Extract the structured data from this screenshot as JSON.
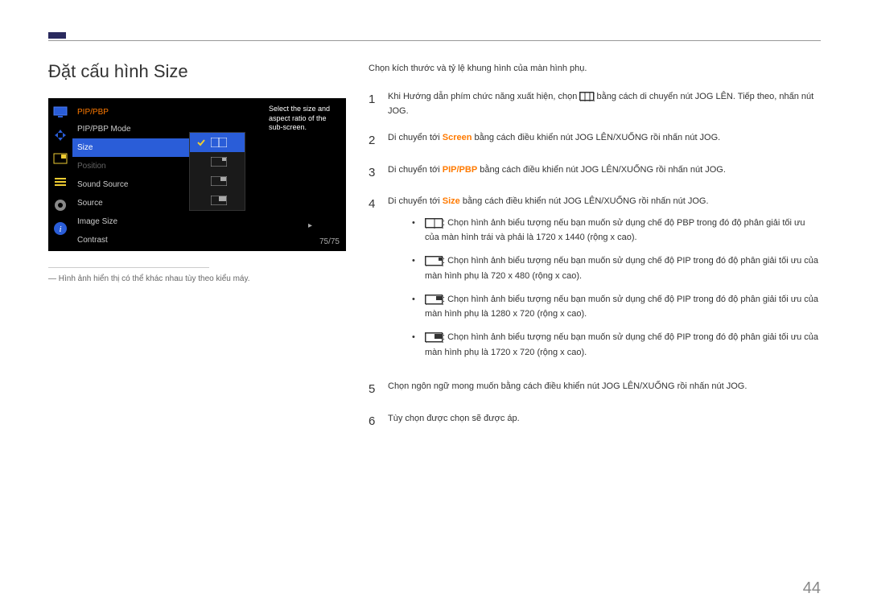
{
  "page_number": "44",
  "title": "Đặt cấu hình Size",
  "note": "― Hình ảnh hiển thị có thể khác nhau tùy theo kiểu máy.",
  "osd": {
    "header": "PIP/PBP",
    "items": [
      {
        "label": "PIP/PBP Mode",
        "state": "normal"
      },
      {
        "label": "Size",
        "state": "selected"
      },
      {
        "label": "Position",
        "state": "disabled"
      },
      {
        "label": "Sound Source",
        "state": "normal"
      },
      {
        "label": "Source",
        "state": "normal"
      },
      {
        "label": "Image Size",
        "state": "normal"
      },
      {
        "label": "Contrast",
        "state": "normal"
      }
    ],
    "tooltip": "Select the size and aspect ratio of the sub-screen.",
    "page": "75/75"
  },
  "intro": "Chọn kích thước và tỷ lệ khung hình của màn hình phụ.",
  "steps": {
    "s1a": "Khi Hướng dẫn phím chức năng xuất hiện, chọn ",
    "s1b": " bằng cách di chuyển nút JOG LÊN. Tiếp theo, nhấn nút JOG.",
    "s2a": "Di chuyển tới ",
    "s2label": "Screen",
    "s2b": " bằng cách điều khiển nút JOG LÊN/XUỐNG rồi nhấn nút JOG.",
    "s3a": "Di chuyển tới ",
    "s3label": "PIP/PBP",
    "s3b": " bằng cách điều khiển nút JOG LÊN/XUỐNG rồi nhấn nút JOG.",
    "s4a": "Di chuyển tới ",
    "s4label": "Size",
    "s4b": " bằng cách điều khiển nút JOG LÊN/XUỐNG rồi nhấn nút JOG.",
    "s5": "Chọn ngôn ngữ mong muốn bằng cách điều khiển nút JOG LÊN/XUỐNG rồi nhấn nút JOG.",
    "s6": "Tùy chọn được chọn sẽ được áp."
  },
  "bullets": {
    "b1": ": Chọn hình ảnh biểu tượng nếu bạn muốn sử dụng chế độ PBP trong đó độ phân giải tối ưu của màn hình trái và phải là 1720 x 1440 (rộng x cao).",
    "b2": ": Chọn hình ảnh biểu tượng nếu bạn muốn sử dụng chế độ PIP trong đó độ phân giải tối ưu của màn hình phụ là 720 x 480 (rộng x cao).",
    "b3": ": Chọn hình ảnh biểu tượng nếu bạn muốn sử dụng chế độ PIP trong đó độ phân giải tối ưu của màn hình phụ là 1280 x 720 (rộng x cao).",
    "b4": ": Chọn hình ảnh biểu tượng nếu bạn muốn sử dụng chế độ PIP trong đó độ phân giải tối ưu của màn hình phụ là 1720 x 720 (rộng x cao)."
  }
}
